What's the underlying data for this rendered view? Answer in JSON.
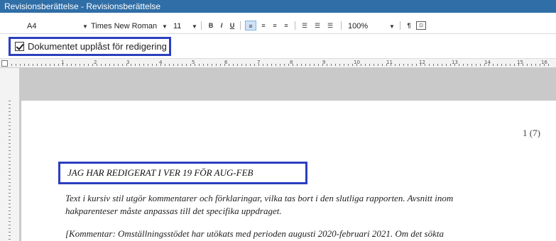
{
  "window": {
    "title": "Revisionsberättelse - Revisionsberättelse"
  },
  "toolbar": {
    "paper_size": "A4",
    "font_name": "Times New Roman",
    "font_size": "11",
    "bold": "B",
    "italic": "I",
    "underline": "U",
    "zoom": "100%",
    "pilcrow": "¶"
  },
  "checkbox": {
    "label": "Dokumentet upplåst för redigering",
    "checked": true
  },
  "ruler": {
    "labels": [
      "1",
      "2",
      "3",
      "4",
      "5",
      "6",
      "7",
      "8",
      "9",
      "10",
      "11",
      "12",
      "13",
      "14",
      "15",
      "16"
    ]
  },
  "document": {
    "page_number": "1 (7)",
    "heading": "JAG HAR REDIGERAT I VER 19 FÖR AUG-FEB",
    "paragraph1_line1": "Text i kursiv stil utgör kommentarer och förklaringar, vilka tas bort i den slutliga rapporten. Avsnitt inom",
    "paragraph1_line2": "hakparenteser måste anpassas till det specifika uppdraget.",
    "paragraph2_line1": "[Kommentar: Omställningsstödet har utökats med perioden augusti 2020-februari 2021. Om det sökta"
  }
}
